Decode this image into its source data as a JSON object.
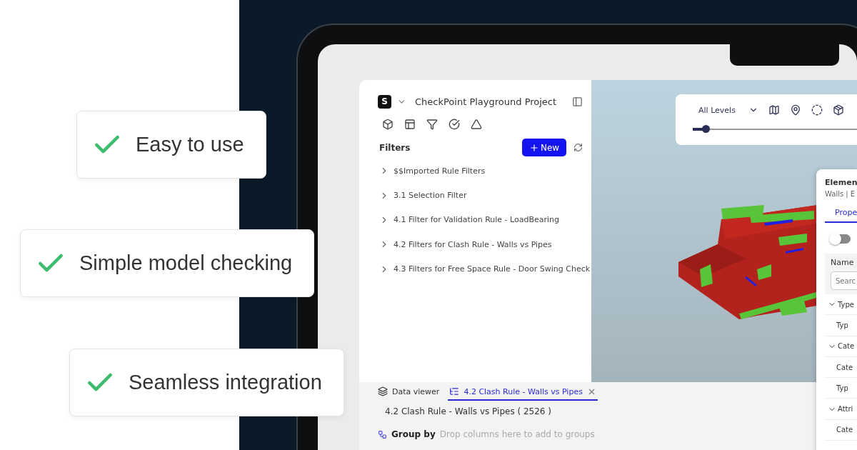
{
  "features": [
    {
      "label": "Easy to use"
    },
    {
      "label": "Simple model checking"
    },
    {
      "label": "Seamless integration"
    }
  ],
  "app": {
    "sidebar": {
      "logo_letter": "S",
      "project_title": "CheckPoint Playground Project",
      "filters": {
        "title": "Filters",
        "new_button": "New",
        "items": [
          {
            "label": "$$Imported Rule Filters",
            "expanded": false
          },
          {
            "label": "3.1 Selection Filter",
            "expanded": false
          },
          {
            "label": "4.1 Filter for Validation Rule - LoadBearing",
            "expanded": false
          },
          {
            "label": "4.2 Filters for Clash Rule - Walls vs Pipes",
            "expanded": false
          },
          {
            "label": "4.3 Filters for Free Space Rule - Door Swing Check",
            "expanded": false
          }
        ]
      }
    },
    "viewer": {
      "level_select": "All Levels",
      "level_slider": {
        "level": 0.08
      }
    },
    "element_panel": {
      "title": "Elemen",
      "subtitle": "Walls | E",
      "tabs": [
        {
          "label": "Prope",
          "selected": true
        }
      ],
      "toggle": {
        "on": false
      },
      "table": {
        "header": "Name",
        "search": {
          "placeholder": "Searc"
        },
        "rows": [
          {
            "label": "Type",
            "expanded": true,
            "children": [
              {
                "label": "Typ"
              }
            ]
          },
          {
            "label": "Cate",
            "expanded": true,
            "children": [
              {
                "label": "Cate"
              },
              {
                "label": "Typ"
              }
            ]
          },
          {
            "label": "Attri",
            "expanded": true,
            "children": [
              {
                "label": "Cate"
              }
            ]
          }
        ]
      }
    },
    "bottom": {
      "tabs": [
        {
          "label": "Data viewer",
          "selected": false,
          "closable": false
        },
        {
          "label": "4.2 Clash Rule - Walls vs Pipes",
          "selected": true,
          "closable": true
        }
      ],
      "result_title": "4.2 Clash Rule - Walls vs Pipes ( 2526 )",
      "group_by": {
        "label": "Group by",
        "placeholder": "Drop columns here to add to groups"
      }
    }
  }
}
